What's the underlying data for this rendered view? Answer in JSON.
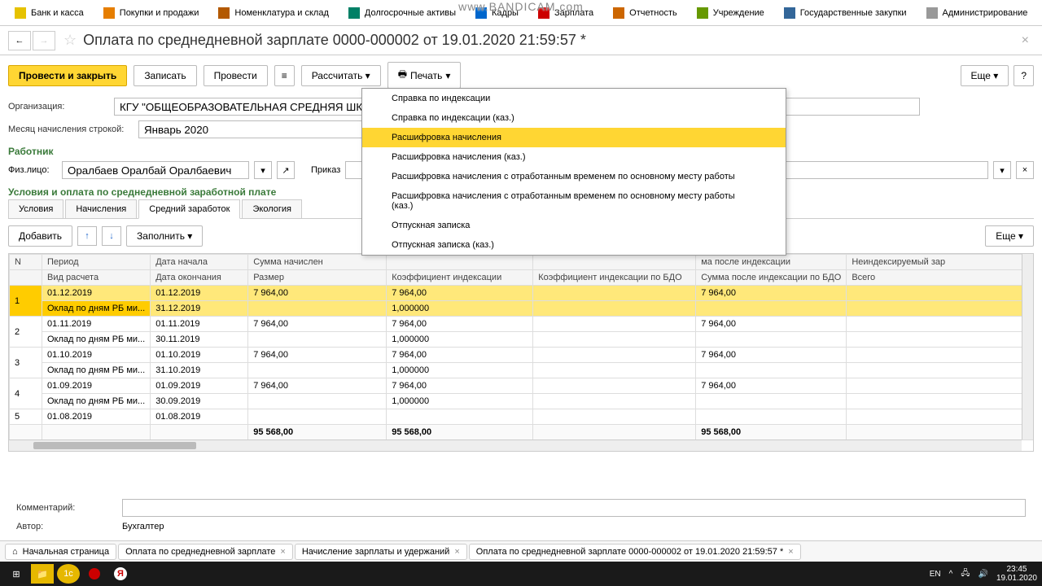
{
  "watermark": "www.BANDICAM.com",
  "topnav": [
    {
      "icon": "#e6c200",
      "label": "Банк и касса"
    },
    {
      "icon": "#e67e00",
      "label": "Покупки и продажи"
    },
    {
      "icon": "#b35900",
      "label": "Номенклатура и склад"
    },
    {
      "icon": "#008066",
      "label": "Долгосрочные активы"
    },
    {
      "icon": "#0066cc",
      "label": "Кадры"
    },
    {
      "icon": "#cc0000",
      "label": "Зарплата"
    },
    {
      "icon": "#cc6600",
      "label": "Отчетность"
    },
    {
      "icon": "#669900",
      "label": "Учреждение"
    },
    {
      "icon": "#336699",
      "label": "Государственные закупки"
    },
    {
      "icon": "#999",
      "label": "Администрирование"
    }
  ],
  "title": "Оплата по среднедневной зарплате 0000-000002 от 19.01.2020 21:59:57 *",
  "toolbar": {
    "commit": "Провести и закрыть",
    "save": "Записать",
    "post": "Провести",
    "calc": "Рассчитать",
    "print": "Печать",
    "more": "Еще"
  },
  "form": {
    "org_label": "Организация:",
    "org_value": "КГУ \"ОБЩЕОБРАЗОВАТЕЛЬНАЯ СРЕДНЯЯ ШКОЛА №3 И",
    "month_label": "Месяц начисления строкой:",
    "month_value": "Январь 2020",
    "emp_section": "Работник",
    "emp_label": "Физ.лицо:",
    "emp_value": "Оралбаев Оралбай Оралбаевич",
    "order_label": "Приказ",
    "cond_section": "Условия и оплата по среднедневной заработной плате",
    "comment_label": "Комментарий:",
    "author_label": "Автор:",
    "author_value": "Бухгалтер"
  },
  "tabs": [
    "Условия",
    "Начисления",
    "Средний заработок",
    "Экология"
  ],
  "tab_toolbar": {
    "add": "Добавить",
    "fill": "Заполнить",
    "more": "Еще"
  },
  "grid": {
    "headers1": [
      "N",
      "Период",
      "Дата начала",
      "Сумма начислен",
      "",
      "",
      "",
      "ма после индексации",
      "Неиндексируемый зар"
    ],
    "headers2": [
      "",
      "Вид расчета",
      "Дата окончания",
      "Размер",
      "Коэффициент индексации",
      "Коэффициент индексации по БДО",
      "Сумма после индексации по БДО",
      "Всего"
    ],
    "rows": [
      {
        "n": "1",
        "period": "01.12.2019",
        "start": "01.12.2019",
        "amt1": "7 964,00",
        "amt2": "7 964,00",
        "amt3": "7 964,00",
        "kind": "Оклад по дням РБ ми...",
        "end": "31.12.2019",
        "coef": "1,000000"
      },
      {
        "n": "2",
        "period": "01.11.2019",
        "start": "01.11.2019",
        "amt1": "7 964,00",
        "amt2": "7 964,00",
        "amt3": "7 964,00",
        "kind": "Оклад по дням РБ ми...",
        "end": "30.11.2019",
        "coef": "1,000000"
      },
      {
        "n": "3",
        "period": "01.10.2019",
        "start": "01.10.2019",
        "amt1": "7 964,00",
        "amt2": "7 964,00",
        "amt3": "7 964,00",
        "kind": "Оклад по дням РБ ми...",
        "end": "31.10.2019",
        "coef": "1,000000"
      },
      {
        "n": "4",
        "period": "01.09.2019",
        "start": "01.09.2019",
        "amt1": "7 964,00",
        "amt2": "7 964,00",
        "amt3": "7 964,00",
        "kind": "Оклад по дням РБ ми...",
        "end": "30.09.2019",
        "coef": "1,000000"
      },
      {
        "n": "5",
        "period": "01.08.2019",
        "start": "01.08.2019"
      }
    ],
    "totals": {
      "c1": "95 568,00",
      "c2": "95 568,00",
      "c3": "95 568,00"
    }
  },
  "dropdown": [
    "Справка по индексации",
    "Справка по индексации (каз.)",
    "Расшифровка начисления",
    "Расшифровка начисления (каз.)",
    "Расшифровка начисления с отработанным временем по основному месту работы",
    "Расшифровка начисления с отработанным временем по основному месту работы (каз.)",
    "Отпускная записка",
    "Отпускная записка (каз.)"
  ],
  "bottom_tabs": [
    "Начальная страница",
    "Оплата по среднедневной зарплате",
    "Начисление зарплаты и удержаний",
    "Оплата по среднедневной зарплате 0000-000002 от 19.01.2020 21:59:57 *"
  ],
  "tray": {
    "lang": "EN",
    "time": "23:45",
    "date": "19.01.2020"
  }
}
